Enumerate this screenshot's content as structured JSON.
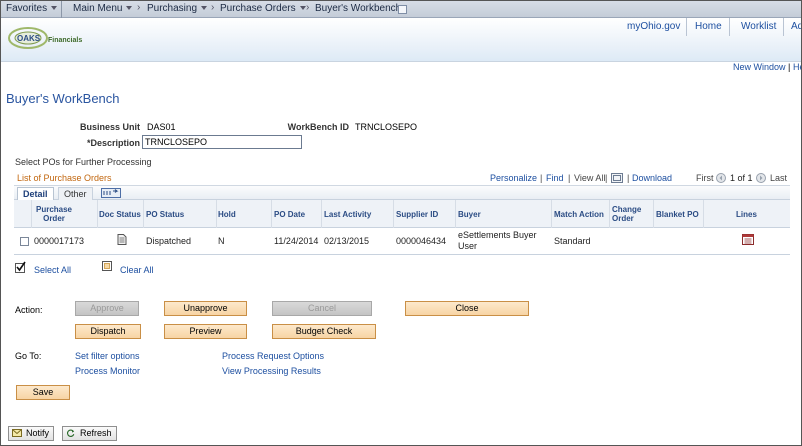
{
  "topbar": {
    "favorites": "Favorites",
    "main_menu": "Main Menu",
    "breadcrumb": [
      "Purchasing",
      "Purchase Orders",
      "Buyer's Workbench"
    ]
  },
  "header": {
    "logo_text": "OAKS",
    "logo_sub": "Financials",
    "links": [
      "myOhio.gov",
      "Home",
      "Worklist",
      "Add"
    ]
  },
  "new_window": "New Window",
  "new_window_extra": "He",
  "page_title": "Buyer's WorkBench",
  "form": {
    "business_unit_label": "Business Unit",
    "business_unit_value": "DAS01",
    "workbench_id_label": "WorkBench ID",
    "workbench_id_value": "TRNCLOSEPO",
    "description_label": "*Description",
    "description_value": "TRNCLOSEPO",
    "select_pos": "Select POs for Further Processing"
  },
  "grid": {
    "title": "List of Purchase Orders",
    "personalize": "Personalize",
    "find": "Find",
    "view_all": "View All",
    "download": "Download",
    "first": "First",
    "range": "1 of 1",
    "last": "Last",
    "tabs": [
      "Detail",
      "Other"
    ],
    "columns": [
      "Purchase Order",
      "Doc Status",
      "PO Status",
      "Hold",
      "PO Date",
      "Last Activity",
      "Supplier ID",
      "Buyer",
      "Match Action",
      "Change Order",
      "Blanket PO",
      "Lines"
    ],
    "rows": [
      {
        "po": "0000017173",
        "po_status": "Dispatched",
        "hold": "N",
        "po_date": "11/24/2014",
        "last_activity": "02/13/2015",
        "supplier_id": "0000046434",
        "buyer": "eSettlements Buyer User",
        "match_action": "Standard"
      }
    ]
  },
  "select_all": "Select All",
  "clear_all": "Clear All",
  "action_label": "Action:",
  "buttons": {
    "approve": "Approve",
    "unapprove": "Unapprove",
    "cancel": "Cancel",
    "close": "Close",
    "dispatch": "Dispatch",
    "preview": "Preview",
    "budget_check": "Budget Check",
    "save": "Save",
    "notify": "Notify",
    "refresh": "Refresh"
  },
  "goto_label": "Go To:",
  "goto_links": [
    "Set filter options",
    "Process Monitor",
    "Process Request Options",
    "View Processing Results"
  ],
  "colors": {
    "link": "#1d4fa0",
    "title": "#2a55a0",
    "grid_title": "#c2670f",
    "button": "#f7d4a4"
  }
}
